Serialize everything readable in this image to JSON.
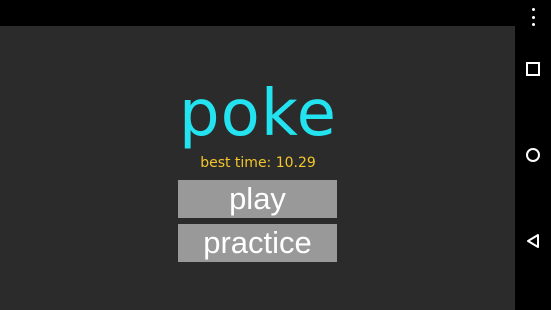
{
  "game": {
    "title": "poke",
    "best_time": "best time: 10.29",
    "play_label": "play",
    "practice_label": "practice"
  },
  "colors": {
    "background": "#2b2b2b",
    "title": "#22e3ef",
    "best_time": "#f2c62c",
    "button_bg": "#999999",
    "button_text": "#ffffff"
  },
  "nav": {
    "icons": [
      "overflow-menu-icon",
      "recent-apps-icon",
      "home-icon",
      "back-icon"
    ]
  }
}
